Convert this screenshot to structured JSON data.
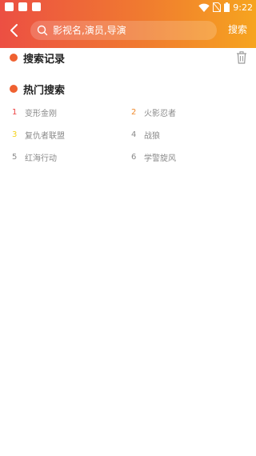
{
  "status_bar": {
    "time": "9:22"
  },
  "header": {
    "search": {
      "placeholder": "影视名,演员,导演"
    },
    "search_button": "搜索"
  },
  "history_section": {
    "title": "搜索记录"
  },
  "hot_section": {
    "title": "热门搜索",
    "items": [
      {
        "rank": "1",
        "label": "变形金刚",
        "rank_color": "#ee4040"
      },
      {
        "rank": "2",
        "label": "火影忍者",
        "rank_color": "#f08a2c"
      },
      {
        "rank": "3",
        "label": "复仇者联盟",
        "rank_color": "#f4d21c"
      },
      {
        "rank": "4",
        "label": "战狼",
        "rank_color": "#8a8a8a"
      },
      {
        "rank": "5",
        "label": "红海行动",
        "rank_color": "#8a8a8a"
      },
      {
        "rank": "6",
        "label": "学警旋风",
        "rank_color": "#8a8a8a"
      }
    ]
  },
  "colors": {
    "accent": "#ef6131",
    "gradient_start": "#ec4f43",
    "gradient_end": "#f6a41f"
  }
}
